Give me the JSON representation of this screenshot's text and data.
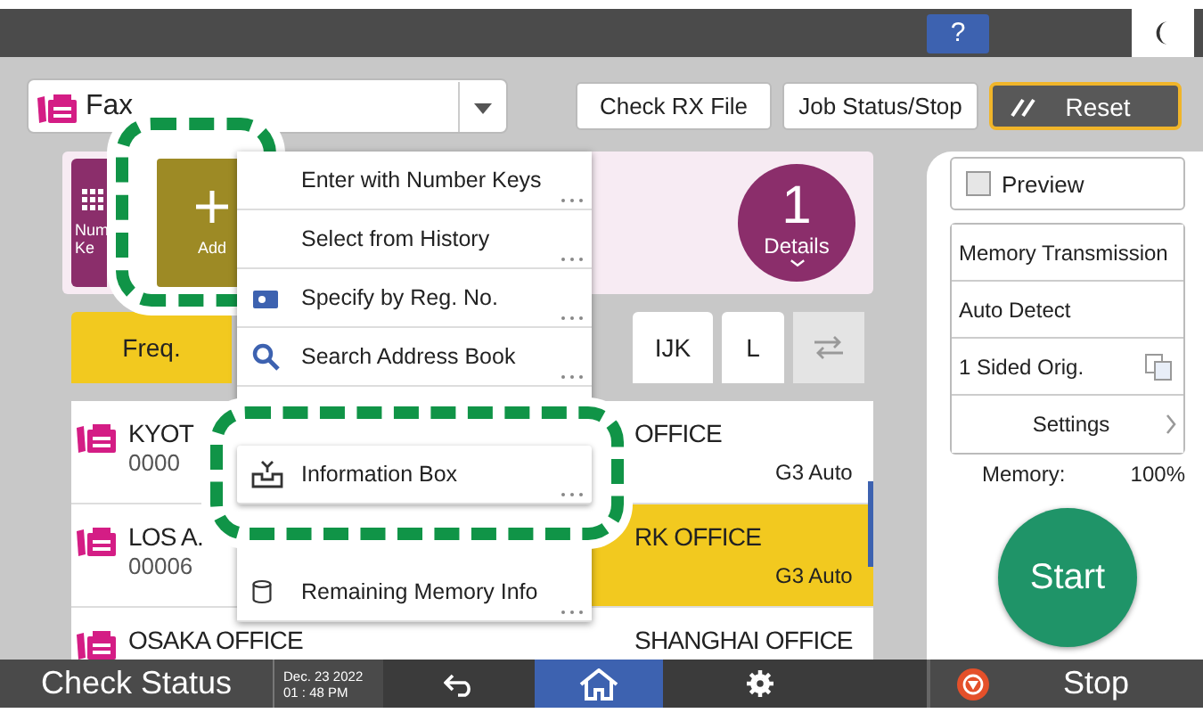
{
  "top_bar": {
    "help_button": "?"
  },
  "function_selector": {
    "label": "Fax"
  },
  "header_buttons": [
    {
      "label": "Check RX File",
      "kind": "plain"
    },
    {
      "label": "Job Status/Stop",
      "kind": "plain"
    },
    {
      "label": "Reset",
      "kind": "reset"
    }
  ],
  "destination_panel": {
    "number_keys_tile": {
      "lines": [
        "Num",
        "Ke"
      ]
    },
    "add_tile": {
      "label": "Add",
      "highlighted": true
    },
    "count_badge": {
      "count": "1",
      "label": "Details"
    }
  },
  "tabs_left": [
    {
      "label": "Freq.",
      "selected": true
    }
  ],
  "tabs_right": [
    {
      "label": "IJK",
      "selected": false
    },
    {
      "label": "L",
      "selected": false
    }
  ],
  "destinations": {
    "left": [
      {
        "name": "KYOT",
        "number": "0000",
        "selected": false
      },
      {
        "name": "LOS A.",
        "number": "00006",
        "selected": false
      },
      {
        "name": "OSAKA OFFICE",
        "selected": false
      }
    ],
    "right": [
      {
        "name": "OFFICE",
        "mode": "G3 Auto",
        "selected": false
      },
      {
        "name": "RK OFFICE",
        "mode": "G3 Auto",
        "selected": true
      },
      {
        "name": "SHANGHAI OFFICE",
        "selected": false
      }
    ]
  },
  "menu": {
    "items": [
      {
        "label": "Enter with Number Keys",
        "kind": "plain",
        "highlighted": false
      },
      {
        "label": "Select from History",
        "kind": "plain",
        "highlighted": false
      },
      {
        "label": "Specify by Reg. No.",
        "kind": "reg_no",
        "highlighted": false
      },
      {
        "label": "Search Address Book",
        "kind": "search",
        "highlighted": false
      },
      {
        "kind": "hidden"
      },
      {
        "label": "Information Box",
        "kind": "info_box",
        "highlighted": true
      },
      {
        "kind": "hidden"
      },
      {
        "label": "Remaining Memory Info",
        "kind": "memory",
        "highlighted": false
      }
    ]
  },
  "settings_panel": {
    "preview": {
      "label": "Preview",
      "checked": false
    },
    "options": [
      {
        "label": "Memory Transmission",
        "kind": "text"
      },
      {
        "label": "Auto Detect",
        "kind": "text"
      },
      {
        "label": "1 Sided Orig.",
        "kind": "sides"
      },
      {
        "label": "Settings",
        "kind": "link"
      }
    ],
    "memory_label": "Memory:",
    "memory_value": "100%",
    "start_button": "Start"
  },
  "bottom_bar": {
    "check_status": "Check Status",
    "date": "Dec. 23 2022",
    "time": "01 : 48 PM",
    "home_selected": true,
    "stop_button": "Stop"
  }
}
